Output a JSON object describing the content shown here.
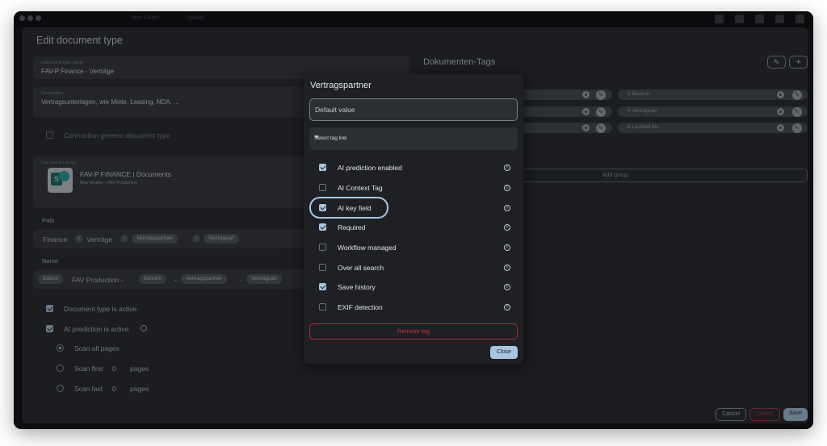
{
  "toolbar": {
    "new_folder": "New Folder",
    "upload": "Upload"
  },
  "form": {
    "title": "Edit document type",
    "doc_type_name_label": "Document type name",
    "doc_type_name_value": "FAV-P Finance - Verträge",
    "description_label": "Description",
    "description_value": "Vertragsunterlagen, wie Miete, Leasing, NDA, ...",
    "connection_label": "Connection general document type",
    "library_label": "Document Library",
    "library_name": "FAV-P FINANCE | Documents",
    "library_sub": "Max Muster - FAV Production",
    "path_label": "Path",
    "path": {
      "p1": "Finance",
      "p2": "Verträge",
      "p3": "Vertragspartner",
      "p4": "Vertragsart"
    },
    "name_label": "Name",
    "name": {
      "datum": "Datum",
      "text": "FAV Production -",
      "bereich": "Bereich",
      "partner": "Vertragspartner",
      "art": "Vertragsart",
      "dash": "-"
    },
    "doc_active": "Document type is active",
    "ai_active": "AI prediction is active",
    "scan_all": "Scan all pages",
    "scan_first": "Scan first",
    "scan_last": "Scan last",
    "pages": "pages",
    "zero": "0"
  },
  "tags": {
    "title": "Dokumenten-Tags",
    "right": [
      "2  Bereich",
      "4  Vertragsart",
      "6  Laufzeit bis"
    ],
    "add_group": "Add group"
  },
  "footer": {
    "cancel": "Cancel",
    "delete": "Delete",
    "save": "Save"
  },
  "modal": {
    "title": "Vertragspartner",
    "default_value": "Default value",
    "select_tag_link": "Select tag link",
    "options": [
      {
        "label": "AI prediction enabled",
        "checked": true
      },
      {
        "label": "AI Context Tag",
        "checked": false
      },
      {
        "label": "AI key field",
        "checked": true
      },
      {
        "label": "Required",
        "checked": true
      },
      {
        "label": "Workflow managed",
        "checked": false
      },
      {
        "label": "Over all search",
        "checked": false
      },
      {
        "label": "Save history",
        "checked": true
      },
      {
        "label": "EXIF detection",
        "checked": false
      }
    ],
    "remove_tag": "Remove tag",
    "close": "Close"
  },
  "colors": {
    "accent": "#a9c6e0",
    "danger": "#c8323e",
    "panel": "#1b1d21"
  }
}
